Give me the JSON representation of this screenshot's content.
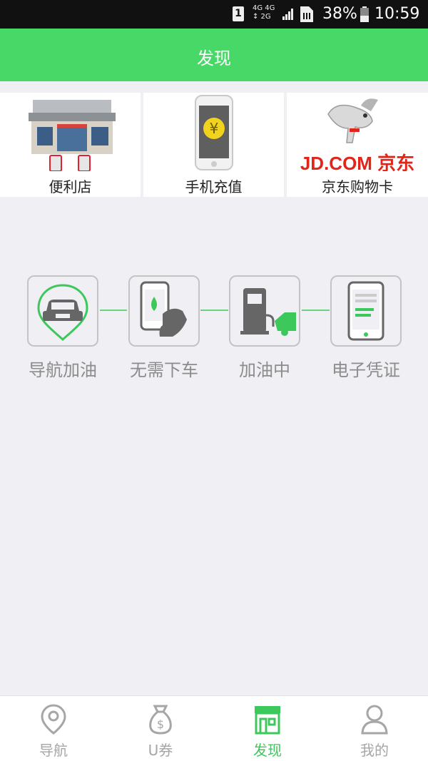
{
  "status_bar": {
    "sim_slot": "1",
    "network_top": "4G 4G",
    "network_bottom": "↕ 2G",
    "battery": "38%",
    "time": "10:59"
  },
  "header": {
    "title": "发现"
  },
  "services": [
    {
      "label": "便利店",
      "icon": "gas-station-store-icon"
    },
    {
      "label": "手机充值",
      "icon": "phone-recharge-icon"
    },
    {
      "label": "京东购物卡",
      "icon": "jd-logo-icon",
      "logo_text": "JD.COM 京东"
    }
  ],
  "process_steps": [
    {
      "label": "导航加油",
      "icon": "car-location-icon"
    },
    {
      "label": "无需下车",
      "icon": "phone-pay-icon"
    },
    {
      "label": "加油中",
      "icon": "fuel-pump-icon"
    },
    {
      "label": "电子凭证",
      "icon": "e-receipt-icon"
    }
  ],
  "tab_bar": {
    "active": "发现",
    "tabs": [
      {
        "label": "导航",
        "icon": "location-pin-icon"
      },
      {
        "label": "U券",
        "icon": "money-bag-icon"
      },
      {
        "label": "发现",
        "icon": "storefront-icon"
      },
      {
        "label": "我的",
        "icon": "user-icon"
      }
    ]
  },
  "colors": {
    "brand_green": "#48d868",
    "jd_red": "#e1251b",
    "background": "#efeff4"
  }
}
